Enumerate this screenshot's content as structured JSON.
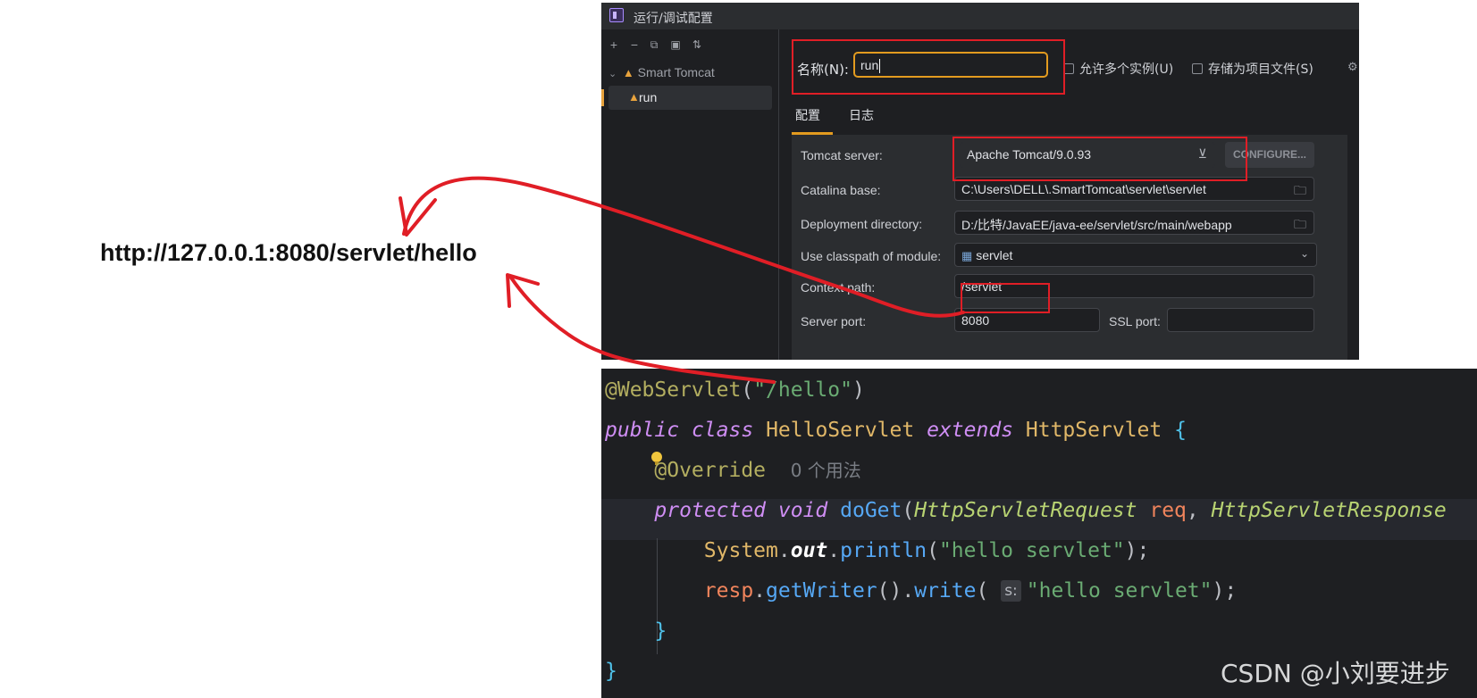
{
  "url_text": "http://127.0.0.1:8080/servlet/hello",
  "dialog": {
    "title": "运行/调试配置",
    "toolbar_icons": [
      "add-icon",
      "remove-icon",
      "copy-icon",
      "folder-move-icon",
      "sort-icon"
    ],
    "tree": {
      "group_label": "Smart Tomcat",
      "item_label": "run"
    },
    "name_label": "名称(N):",
    "name_value": "run",
    "allow_parallel_label": "允许多个实例(U)",
    "store_project_label": "存储为项目文件(S)",
    "tabs": [
      "配置",
      "日志"
    ],
    "form": {
      "tomcat_server_label": "Tomcat server:",
      "tomcat_server_value": "Apache Tomcat/9.0.93",
      "configure_label": "CONFIGURE...",
      "catalina_base_label": "Catalina base:",
      "catalina_base_value": "C:\\Users\\DELL\\.SmartTomcat\\servlet\\servlet",
      "deployment_dir_label": "Deployment directory:",
      "deployment_dir_value": "D:/比特/JavaEE/java-ee/servlet/src/main/webapp",
      "classpath_label": "Use classpath of module:",
      "classpath_value": "servlet",
      "context_path_label": "Context path:",
      "context_path_value": "/servlet",
      "server_port_label": "Server port:",
      "server_port_value": "8080",
      "ssl_port_label": "SSL port:",
      "ssl_port_value": ""
    }
  },
  "code": {
    "annotation": "@WebServlet",
    "annotation_open": "(",
    "annotation_arg": "\"/hello\"",
    "annotation_close": ")",
    "kw_public": "public",
    "kw_class": "class",
    "class_name": "HelloServlet",
    "kw_extends": "extends",
    "super_class": "HttpServlet",
    "brace_open": "{",
    "override": "@Override",
    "usages_hint": "0 个用法",
    "kw_protected": "protected",
    "kw_void": "void",
    "method_name": "doGet",
    "paren_open": "(",
    "param1_type": "HttpServletRequest",
    "param1_name": "req",
    "comma": ",",
    "param2_type": "HttpServletResponse",
    "system": "System",
    "dot": ".",
    "out": "out",
    "println": "println",
    "str1": "\"hello servlet\"",
    "end": ");",
    "resp": "resp",
    "get_writer": "getWriter",
    "call_parens": "()",
    "write": "write",
    "inlay_s": "s:",
    "str2": "\"hello servlet\"",
    "close_inner": "}",
    "close_outer": "}"
  },
  "watermark": "CSDN @小刘要进步",
  "colors": {
    "annotation_red": "#e01e26",
    "accent_orange": "#e39b1f",
    "ide_background": "#1e1f22"
  }
}
